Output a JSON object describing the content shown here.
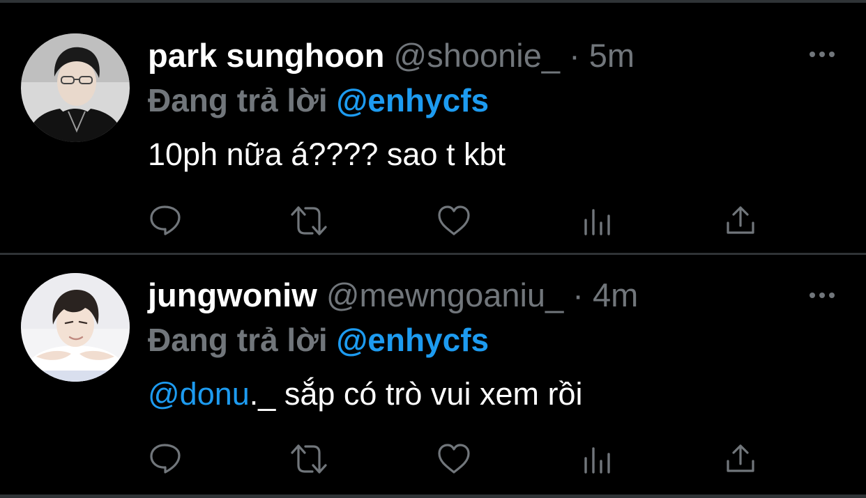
{
  "tweets": [
    {
      "name": "park sunghoon",
      "handle": "@shoonie_",
      "separator": "·",
      "time": "5m",
      "reply_prefix": "Đang trả lời",
      "reply_to": "@enhycfs",
      "body": "10ph nữa á???? sao t kbt",
      "avatar": "profile-photo"
    },
    {
      "name": "jungwoniw",
      "handle": "@mewngoaniu_",
      "separator": "·",
      "time": "4m",
      "reply_prefix": "Đang trả lời",
      "reply_to": "@enhycfs",
      "body_mention": "@donu",
      "body_rest": "._ sắp có trò vui xem rồi",
      "avatar": "profile-photo"
    }
  ],
  "icons": {
    "reply": "reply-icon",
    "retweet": "retweet-icon",
    "like": "heart-icon",
    "views": "analytics-icon",
    "share": "share-icon",
    "more": "more-options-icon"
  },
  "colors": {
    "background": "#000000",
    "text": "#ffffff",
    "muted": "#71767b",
    "accent": "#1d9bf0",
    "divider": "#2f3336"
  }
}
